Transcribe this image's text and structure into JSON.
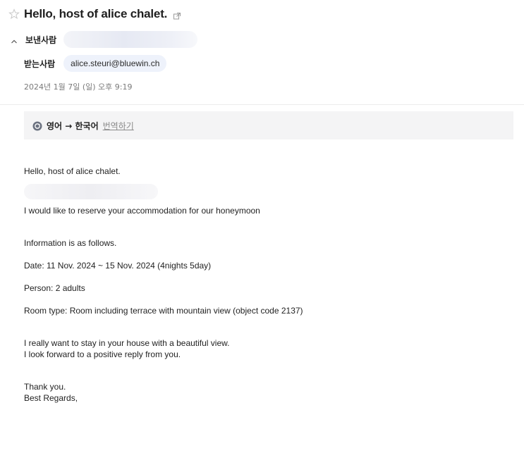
{
  "email": {
    "subject": "Hello, host of alice chalet.",
    "sender_label": "보낸사람",
    "recipient_label": "받는사람",
    "recipient": "alice.steuri@bluewin.ch",
    "date": "2024년 1월 7일 (일) 오후 9:19"
  },
  "translate": {
    "languages": "영어 → 한국어",
    "link": "번역하기"
  },
  "body": {
    "greeting": "Hello, host of alice chalet.",
    "line1": "I would like to reserve your accommodation for our honeymoon",
    "info_intro": "Information is as follows.",
    "date_line": "Date: 11 Nov. 2024 ~  15 Nov. 2024 (4nights 5day)",
    "person_line": "Person: 2 adults",
    "room_line": "Room type: Room including terrace with mountain view (object code 2137)",
    "closing1": "I really want to stay in your house with a beautiful view.",
    "closing2": "I look forward to a positive reply from you.",
    "thanks": "Thank you.",
    "regards": "Best Regards,"
  },
  "icons": {
    "star": "star-icon",
    "external_link": "external-link-icon",
    "chevron": "chevron-up-icon",
    "translate": "translate-icon"
  }
}
